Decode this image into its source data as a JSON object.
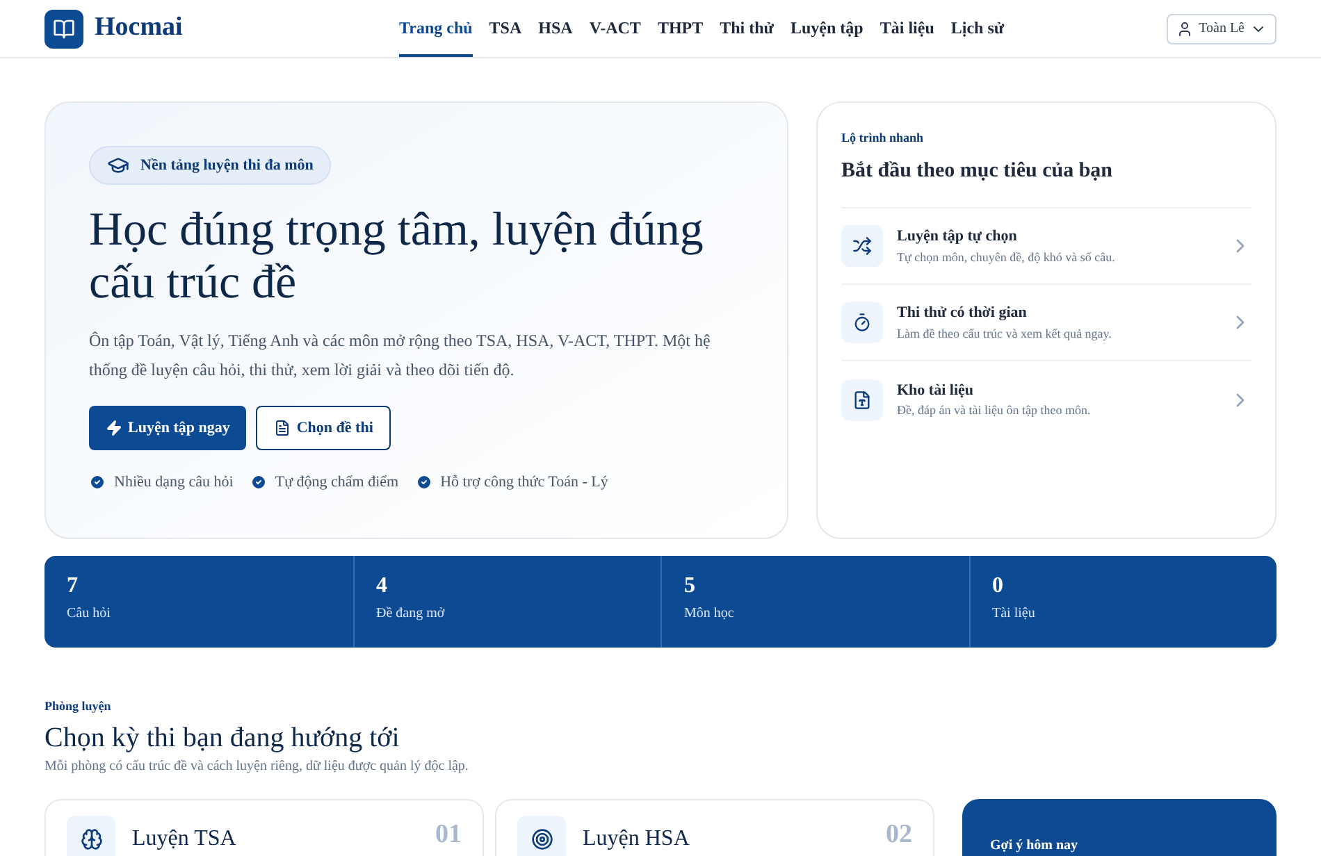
{
  "brand": {
    "name": "Hocmai"
  },
  "nav": [
    {
      "label": "Trang chủ",
      "selected": true
    },
    {
      "label": "TSA",
      "selected": false
    },
    {
      "label": "HSA",
      "selected": false
    },
    {
      "label": "V-ACT",
      "selected": false
    },
    {
      "label": "THPT",
      "selected": false
    },
    {
      "label": "Thi thử",
      "selected": false
    },
    {
      "label": "Luyện tập",
      "selected": false
    },
    {
      "label": "Tài liệu",
      "selected": false
    },
    {
      "label": "Lịch sử",
      "selected": false
    }
  ],
  "user": {
    "name": "Toàn Lê"
  },
  "hero": {
    "badge": "Nền tảng luyện thi đa môn",
    "title": "Học đúng trọng tâm, luyện đúng cấu trúc đề",
    "description": "Ôn tập Toán, Vật lý, Tiếng Anh và các môn mở rộng theo TSA, HSA, V-ACT, THPT. Một hệ thống đề luyện câu hỏi, thi thử, xem lời giải và theo dõi tiến độ.",
    "buttons": [
      {
        "label": "Luyện tập ngay",
        "kind": "primary"
      },
      {
        "label": "Chọn đề thi",
        "kind": "outline"
      }
    ],
    "features": [
      "Nhiều dạng câu hỏi",
      "Tự động chấm điểm",
      "Hỗ trợ công thức Toán - Lý"
    ]
  },
  "quick": {
    "eyebrow": "Lộ trình nhanh",
    "title": "Bắt đầu theo mục tiêu của bạn",
    "items": [
      {
        "kind": "shuffle",
        "title": "Luyện tập tự chọn",
        "subtitle": "Tự chọn môn, chuyên đề, độ khó và số câu."
      },
      {
        "kind": "timer",
        "title": "Thi thử có thời gian",
        "subtitle": "Làm đề theo cấu trúc và xem kết quả ngay."
      },
      {
        "kind": "file",
        "title": "Kho tài liệu",
        "subtitle": "Đề, đáp án và tài liệu ôn tập theo môn."
      }
    ]
  },
  "stats": [
    {
      "value": "7",
      "label": "Câu hỏi"
    },
    {
      "value": "4",
      "label": "Đề đang mở"
    },
    {
      "value": "5",
      "label": "Môn học"
    },
    {
      "value": "0",
      "label": "Tài liệu"
    }
  ],
  "rooms": {
    "eyebrow": "Phòng luyện",
    "title": "Chọn kỳ thi bạn đang hướng tới",
    "subtitle": "Mỗi phòng có cấu trúc đề và cách luyện riêng, dữ liệu được quản lý độc lập.",
    "cards": [
      {
        "kind": "brain",
        "title": "Luyện TSA",
        "number": "01"
      },
      {
        "kind": "target",
        "title": "Luyện HSA",
        "number": "02"
      }
    ],
    "suggestion": {
      "title": "Gợi ý hôm nay"
    }
  }
}
